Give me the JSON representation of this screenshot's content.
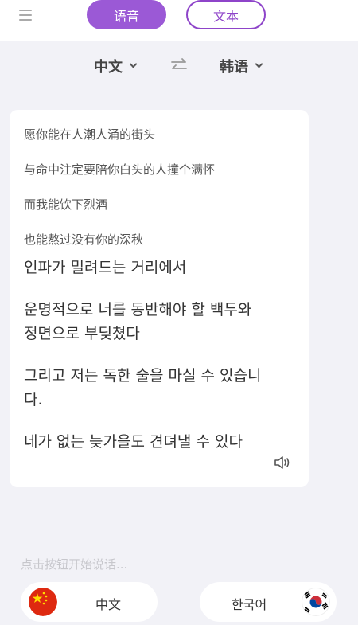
{
  "header": {
    "menu_icon": "menu-icon",
    "tabs": [
      {
        "label": "语音",
        "active": true
      },
      {
        "label": "文本",
        "active": false
      }
    ]
  },
  "language_bar": {
    "source": "中文",
    "target": "韩语",
    "swap_icon": "swap-arrows-icon"
  },
  "translation": {
    "source_lines": [
      "愿你能在人潮人涌的街头",
      "与命中注定要陪你白头的人撞个满怀",
      "而我能饮下烈酒",
      "也能熬过没有你的深秋"
    ],
    "target_lines": [
      [
        "인파가 밀려드는 거리에서"
      ],
      [
        "운명적으로 너를 동반해야 할 백두와",
        "정면으로 부딪쳤다"
      ],
      [
        "그리고 저는 독한 술을 마실 수 있습니",
        "다."
      ],
      [
        "네가 없는 늦가을도 견뎌낼 수 있다"
      ]
    ],
    "speaker_icon": "speaker-icon"
  },
  "hint": "点击按钮开始说话...",
  "bottom": {
    "left_button": {
      "label": "中文",
      "flag": "china-flag-icon"
    },
    "right_button": {
      "label": "한국어",
      "flag": "korea-flag-icon"
    }
  },
  "colors": {
    "accent": "#9b59d6",
    "background": "#f2f2f7"
  }
}
